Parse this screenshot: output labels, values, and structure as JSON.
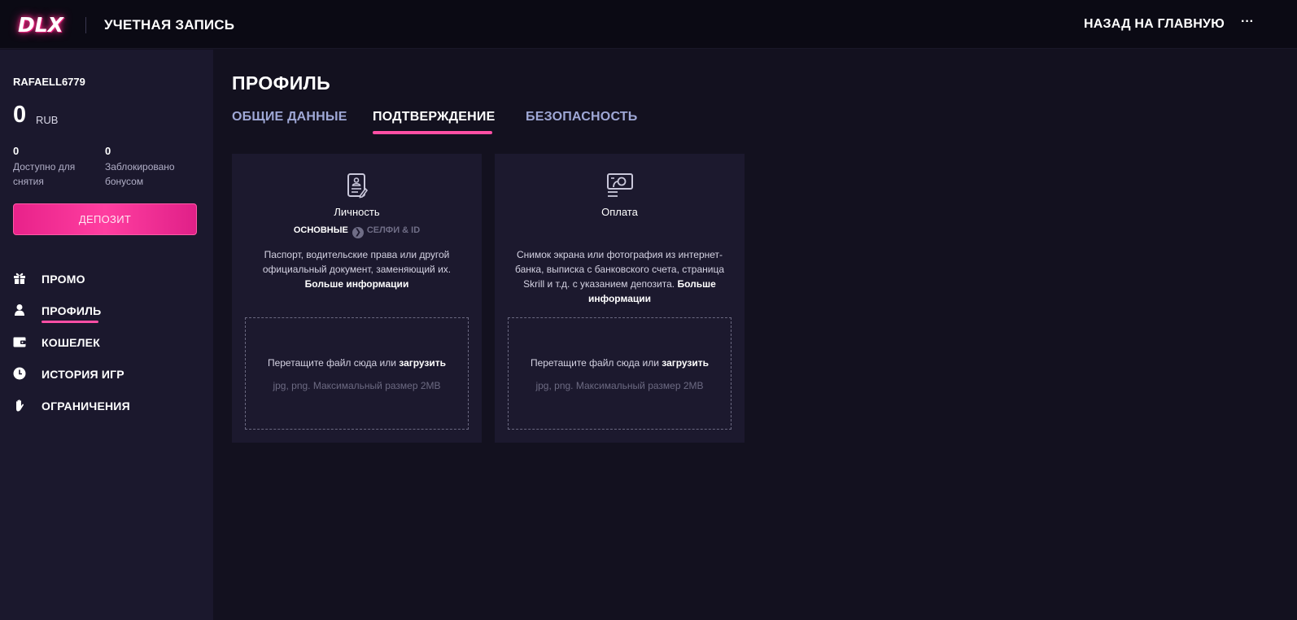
{
  "header": {
    "logo": "DLX",
    "title": "УЧЕТНАЯ ЗАПИСЬ",
    "back_label": "НАЗАД НА ГЛАВНУЮ",
    "more_label": "···"
  },
  "sidebar": {
    "username": "RAFAELL6779",
    "balance": "0",
    "currency": "RUB",
    "available": {
      "value": "0",
      "label": "Доступно для снятия"
    },
    "blocked": {
      "value": "0",
      "label": "Заблокировано бонусом"
    },
    "deposit_label": "ДЕПОЗИТ",
    "nav": [
      {
        "label": "ПРОМО",
        "icon": "gift-icon"
      },
      {
        "label": "ПРОФИЛЬ",
        "icon": "user-icon",
        "active": true
      },
      {
        "label": "КОШЕЛЕК",
        "icon": "wallet-icon"
      },
      {
        "label": "ИСТОРИЯ ИГР",
        "icon": "clock-icon"
      },
      {
        "label": "ОГРАНИЧЕНИЯ",
        "icon": "hand-icon"
      }
    ]
  },
  "main": {
    "title": "ПРОФИЛЬ",
    "tabs": [
      {
        "label": "ОБЩИЕ ДАННЫЕ",
        "active": false
      },
      {
        "label": "ПОДТВЕРЖДЕНИЕ",
        "active": true
      },
      {
        "label": "БЕЗОПАСНОСТЬ",
        "active": false
      }
    ],
    "cards": [
      {
        "icon": "id-document-icon",
        "title": "Личность",
        "step_main": "ОСНОВНЫЕ",
        "step_next": "СЕЛФИ & ID",
        "description": "Паспорт, водительские права или другой официальный документ, заменяющий их.",
        "more_link": "Больше информации",
        "drop_text": "Перетащите файл сюда или",
        "drop_link": "загрузить",
        "drop_hint": "jpg, png. Максимальный размер 2MB"
      },
      {
        "icon": "payment-receipt-icon",
        "title": "Оплата",
        "description": "Снимок экрана или фотография из интернет-банка, выписка с банковского счета, страница Skrill и т.д. с указанием депозита.",
        "more_link": "Больше информации",
        "drop_text": "Перетащите файл сюда или",
        "drop_link": "загрузить",
        "drop_hint": "jpg, png. Максимальный размер 2MB"
      }
    ]
  },
  "colors": {
    "accent": "#ff4fa5",
    "background": "#13111f",
    "sidebar": "#1b182d",
    "card": "#1c192e",
    "tab_inactive": "#9fa8d6"
  }
}
